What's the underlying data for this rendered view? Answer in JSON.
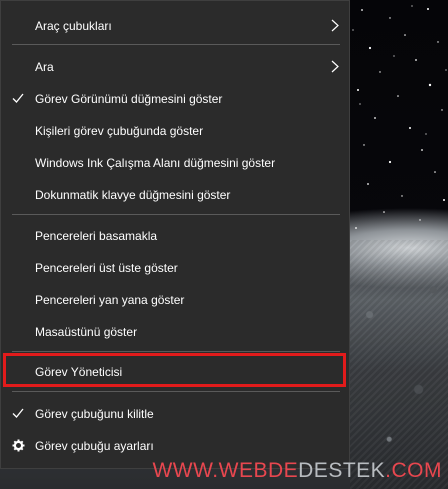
{
  "menu": {
    "items": [
      {
        "label": "Araç çubukları",
        "submenu": true,
        "checked": false
      },
      {
        "label": "Ara",
        "submenu": true,
        "checked": false
      },
      {
        "label": "Görev Görünümü düğmesini göster",
        "submenu": false,
        "checked": true
      },
      {
        "label": "Kişileri görev çubuğunda göster",
        "submenu": false,
        "checked": false
      },
      {
        "label": "Windows Ink Çalışma Alanı düğmesini göster",
        "submenu": false,
        "checked": false
      },
      {
        "label": "Dokunmatik klavye düğmesini göster",
        "submenu": false,
        "checked": false
      },
      {
        "label": "Pencereleri basamakla",
        "submenu": false,
        "checked": false
      },
      {
        "label": "Pencereleri üst üste göster",
        "submenu": false,
        "checked": false
      },
      {
        "label": "Pencereleri yan yana göster",
        "submenu": false,
        "checked": false
      },
      {
        "label": "Masaüstünü göster",
        "submenu": false,
        "checked": false
      },
      {
        "label": "Görev Yöneticisi",
        "submenu": false,
        "checked": false,
        "highlighted": true
      },
      {
        "label": "Görev çubuğunu kilitle",
        "submenu": false,
        "checked": true
      },
      {
        "label": "Görev çubuğu ayarları",
        "submenu": false,
        "checked": false,
        "icon": "gear-icon"
      }
    ]
  },
  "watermark": {
    "part1": "WWW.",
    "part2": "WEBDE",
    "part3": "DESTEK",
    "part4": ".COM"
  },
  "colors": {
    "menu_background": "#2b2b2b",
    "highlight_border": "#e21b1b",
    "watermark_red": "#e8474f"
  }
}
